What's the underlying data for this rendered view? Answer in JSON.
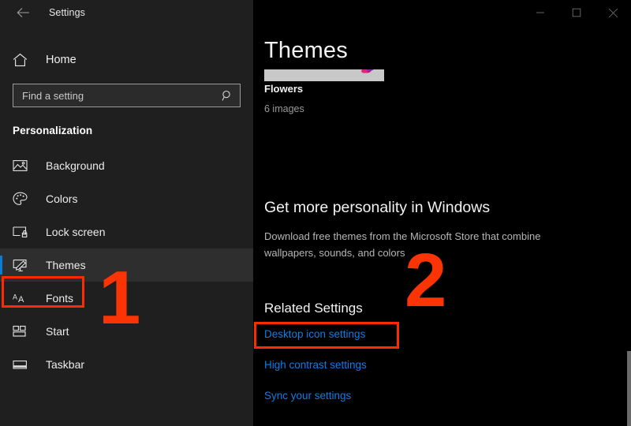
{
  "window": {
    "app_title": "Settings",
    "back_icon": "back-arrow-icon",
    "controls": [
      {
        "name": "minimize",
        "glyph": "minimize-icon"
      },
      {
        "name": "maximize",
        "glyph": "maximize-icon"
      },
      {
        "name": "close",
        "glyph": "close-icon"
      }
    ]
  },
  "sidebar": {
    "home_label": "Home",
    "home_icon": "home-icon",
    "search": {
      "placeholder": "Find a setting",
      "value": "",
      "icon": "search-icon"
    },
    "section_title": "Personalization",
    "items": [
      {
        "label": "Background",
        "icon": "picture-icon",
        "selected": false
      },
      {
        "label": "Colors",
        "icon": "palette-icon",
        "selected": false
      },
      {
        "label": "Lock screen",
        "icon": "lock-screen-icon",
        "selected": false
      },
      {
        "label": "Themes",
        "icon": "themes-brush-icon",
        "selected": true
      },
      {
        "label": "Fonts",
        "icon": "fonts-aa-icon",
        "selected": false
      },
      {
        "label": "Start",
        "icon": "start-tiles-icon",
        "selected": false
      },
      {
        "label": "Taskbar",
        "icon": "taskbar-icon",
        "selected": false
      }
    ]
  },
  "main": {
    "page_title": "Themes",
    "current_theme": {
      "name": "Flowers",
      "count": "6 images"
    },
    "promo": {
      "heading": "Get more personality in Windows",
      "body": "Download free themes from the Microsoft Store that combine wallpapers, sounds, and colors"
    },
    "related": {
      "heading": "Related Settings",
      "links": [
        "Desktop icon settings",
        "High contrast settings",
        "Sync your settings"
      ]
    }
  },
  "annotations": {
    "numbers": [
      "1",
      "2"
    ],
    "highlight_color": "#ff2b00"
  },
  "colors": {
    "sidebar_bg": "#1f1f1f",
    "main_bg": "#000000",
    "accent_blue": "#0a7cd4",
    "link_blue": "#0c7ce8",
    "annotation_red": "#fb3406"
  }
}
